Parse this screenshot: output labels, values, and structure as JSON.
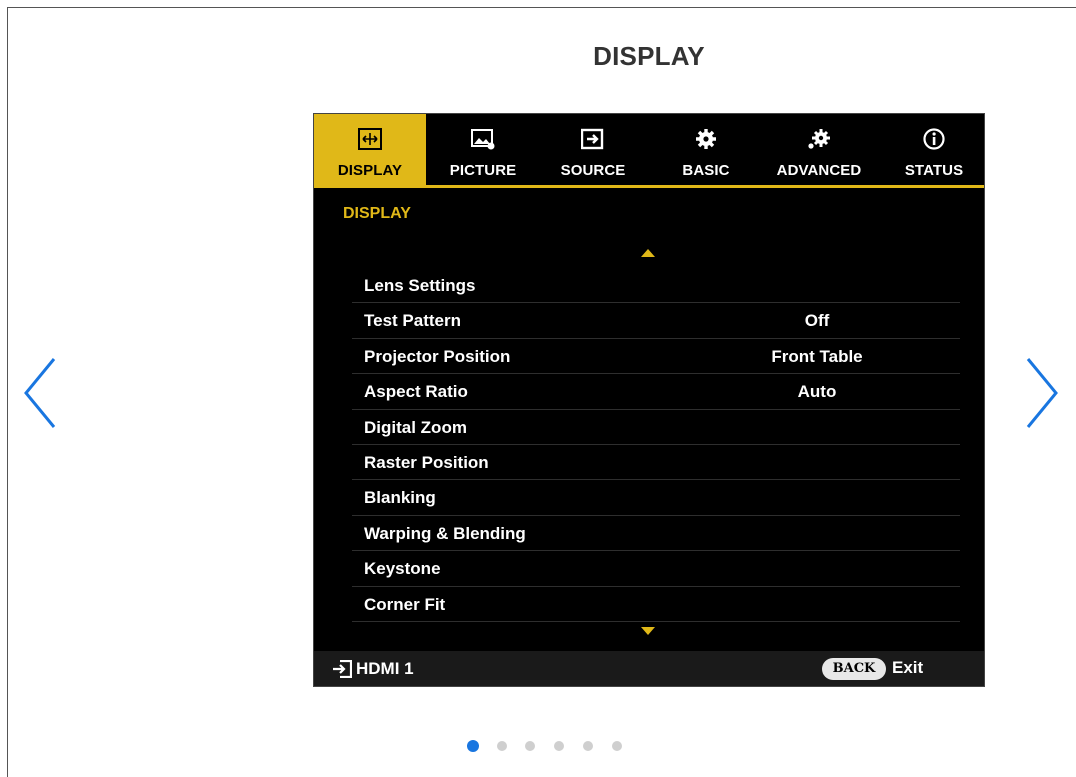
{
  "page": {
    "title": "DISPLAY"
  },
  "colors": {
    "accent": "#e0b818",
    "nav_arrow": "#1976e0",
    "dot_active": "#1976e0",
    "dot_inactive": "#cfcfcf"
  },
  "navigation": {
    "prev_icon": "chevron-left-icon",
    "next_icon": "chevron-right-icon"
  },
  "osd": {
    "tabs": [
      {
        "label": "DISPLAY",
        "icon": "display-frame-icon",
        "active": true
      },
      {
        "label": "PICTURE",
        "icon": "picture-icon",
        "active": false
      },
      {
        "label": "SOURCE",
        "icon": "source-input-icon",
        "active": false
      },
      {
        "label": "BASIC",
        "icon": "gear-icon",
        "active": false
      },
      {
        "label": "ADVANCED",
        "icon": "advanced-gears-icon",
        "active": false
      },
      {
        "label": "STATUS",
        "icon": "info-icon",
        "active": false
      }
    ],
    "section_heading": "DISPLAY",
    "menu_items": [
      {
        "label": "Lens Settings",
        "value": ""
      },
      {
        "label": "Test Pattern",
        "value": "Off"
      },
      {
        "label": "Projector Position",
        "value": "Front Table"
      },
      {
        "label": "Aspect Ratio",
        "value": "Auto"
      },
      {
        "label": "Digital Zoom",
        "value": ""
      },
      {
        "label": "Raster Position",
        "value": ""
      },
      {
        "label": "Blanking",
        "value": ""
      },
      {
        "label": "Warping & Blending",
        "value": ""
      },
      {
        "label": "Keystone",
        "value": ""
      },
      {
        "label": "Corner Fit",
        "value": ""
      }
    ],
    "footer": {
      "source_icon": "input-source-icon",
      "source_label": "HDMI 1",
      "back_button": "BACK",
      "exit_label": "Exit"
    }
  },
  "carousel": {
    "slide_count": 6,
    "active_index": 0
  }
}
